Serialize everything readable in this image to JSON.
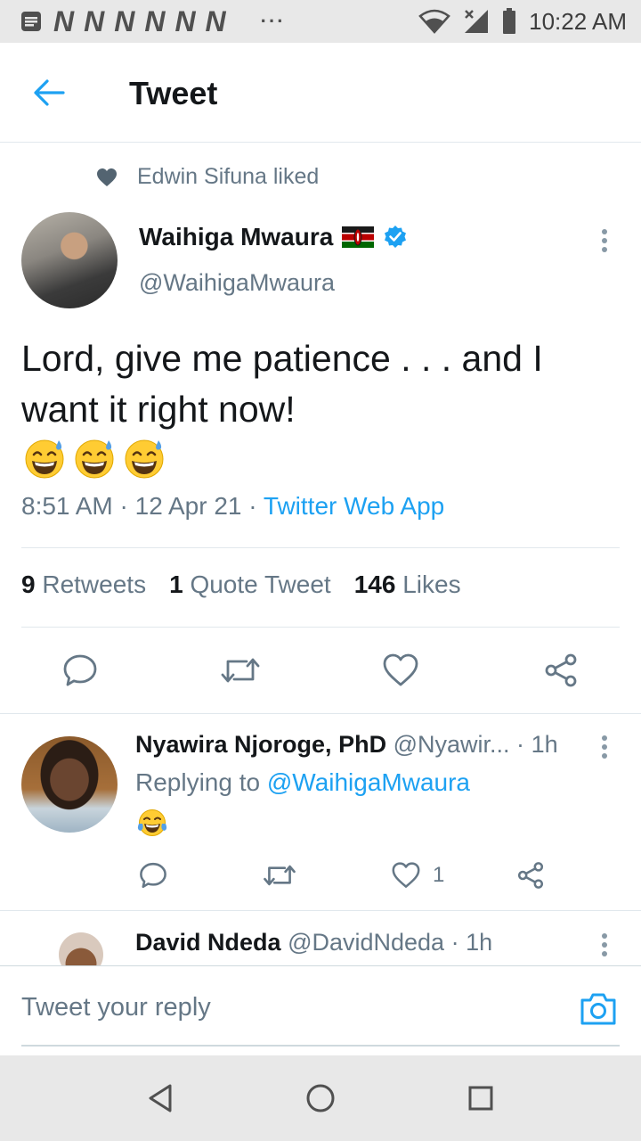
{
  "status_bar": {
    "notification_glyphs": [
      "N",
      "N",
      "N",
      "N",
      "N",
      "N"
    ],
    "overflow": "···",
    "time": "10:22 AM"
  },
  "header": {
    "title": "Tweet"
  },
  "social_context": {
    "text": "Edwin Sifuna liked"
  },
  "tweet": {
    "author_name": "Waihiga Mwaura",
    "flag_icon": "kenya-flag-icon",
    "handle": "@WaihigaMwaura",
    "text": "Lord, give me patience . . . and I want it right now!",
    "emojis": [
      "😅",
      "😅",
      "😅"
    ],
    "time": "8:51 AM",
    "separator": "·",
    "date": "12 Apr 21",
    "source": "Twitter Web App",
    "stats": {
      "retweets_count": "9",
      "retweets_label": "Retweets",
      "quotes_count": "1",
      "quotes_label": "Quote Tweet",
      "likes_count": "146",
      "likes_label": "Likes"
    }
  },
  "replies": [
    {
      "name": "Nyawira Njoroge, PhD",
      "handle": "@Nyawir...",
      "time": "1h",
      "replying_prefix": "Replying to",
      "replying_to": "@WaihigaMwaura",
      "text": "😂",
      "like_count": "1"
    },
    {
      "name": "David Ndeda",
      "handle": "@DavidNdeda",
      "time": "1h"
    }
  ],
  "composer": {
    "placeholder": "Tweet your reply"
  },
  "colors": {
    "accent": "#1da1f2",
    "text_primary": "#14171a",
    "text_secondary": "#657786",
    "divider": "#e1e8ed",
    "system_bar": "#e8e8e8"
  }
}
